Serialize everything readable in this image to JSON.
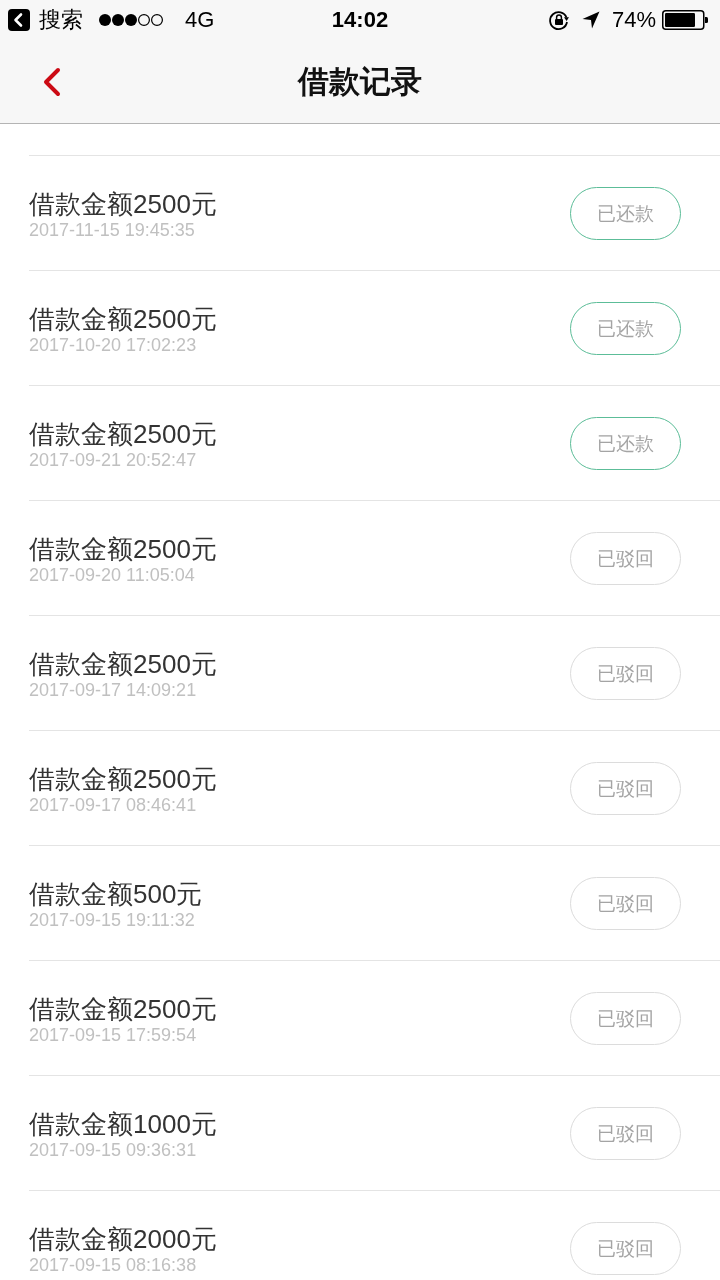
{
  "status_bar": {
    "back_label": "搜索",
    "network": "4G",
    "time": "14:02",
    "battery": "74%"
  },
  "nav": {
    "title": "借款记录"
  },
  "records": [
    {
      "amount": "借款金额2500元",
      "time": "2017-11-15 19:45:35",
      "status": "已还款",
      "kind": "repaid"
    },
    {
      "amount": "借款金额2500元",
      "time": "2017-10-20 17:02:23",
      "status": "已还款",
      "kind": "repaid"
    },
    {
      "amount": "借款金额2500元",
      "time": "2017-09-21 20:52:47",
      "status": "已还款",
      "kind": "repaid"
    },
    {
      "amount": "借款金额2500元",
      "time": "2017-09-20 11:05:04",
      "status": "已驳回",
      "kind": "rejected"
    },
    {
      "amount": "借款金额2500元",
      "time": "2017-09-17 14:09:21",
      "status": "已驳回",
      "kind": "rejected"
    },
    {
      "amount": "借款金额2500元",
      "time": "2017-09-17 08:46:41",
      "status": "已驳回",
      "kind": "rejected"
    },
    {
      "amount": "借款金额500元",
      "time": "2017-09-15 19:11:32",
      "status": "已驳回",
      "kind": "rejected"
    },
    {
      "amount": "借款金额2500元",
      "time": "2017-09-15 17:59:54",
      "status": "已驳回",
      "kind": "rejected"
    },
    {
      "amount": "借款金额1000元",
      "time": "2017-09-15 09:36:31",
      "status": "已驳回",
      "kind": "rejected"
    },
    {
      "amount": "借款金额2000元",
      "time": "2017-09-15 08:16:38",
      "status": "已驳回",
      "kind": "rejected"
    }
  ]
}
